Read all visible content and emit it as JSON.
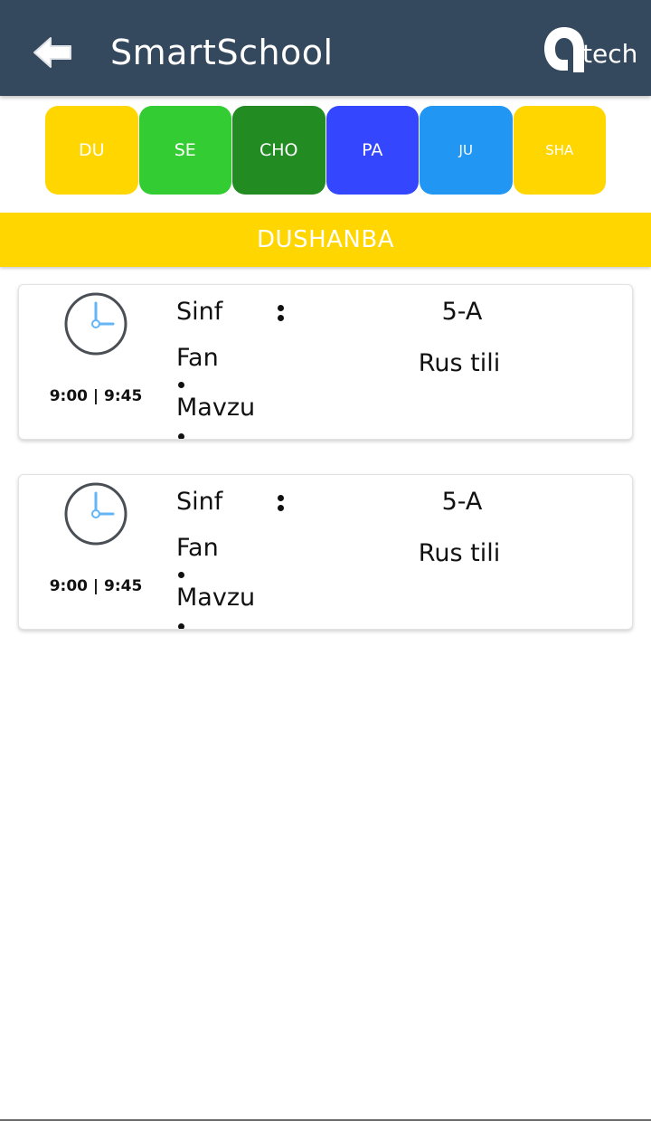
{
  "appbar": {
    "title": "SmartSchool",
    "logo_text": "tech",
    "background": "#35495e"
  },
  "days": [
    {
      "label": "DU",
      "color": "#ffd600"
    },
    {
      "label": "SE",
      "color": "#33cc33"
    },
    {
      "label": "CHO",
      "color": "#228b22"
    },
    {
      "label": "PA",
      "color": "#3447ff"
    },
    {
      "label": "JU",
      "color": "#2196f3"
    },
    {
      "label": "SHA",
      "color": "#ffd600"
    }
  ],
  "selected_day": "DUSHANBA",
  "lessons": [
    {
      "time": "9:00 | 9:45",
      "class_label": "Sinf",
      "subject_label": "Fan",
      "topic_label": "Mavzu",
      "class_value": "5-A",
      "subject_value": "Rus tili"
    },
    {
      "time": "9:00 | 9:45",
      "class_label": "Sinf",
      "subject_label": "Fan",
      "topic_label": "Mavzu",
      "class_value": "5-A",
      "subject_value": "Rus tili"
    }
  ]
}
